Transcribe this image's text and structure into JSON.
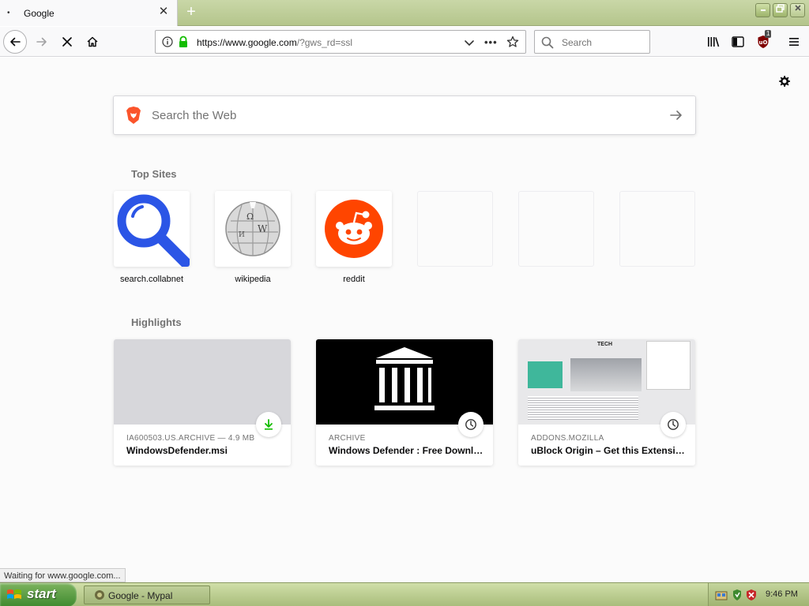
{
  "browser": {
    "tab": {
      "title": "Google",
      "dot": "•"
    },
    "new_tab_symbol": "+",
    "window_controls": {
      "minimize": "_",
      "maximize": "❐",
      "close": "✕"
    }
  },
  "navbar": {
    "url": {
      "main": "https://www.google.com",
      "rest": "/?gws_rd=ssl"
    },
    "more_symbol": "•••",
    "search_placeholder": "Search",
    "ublock_count": "1"
  },
  "newtab": {
    "search_placeholder": "Search the Web",
    "top_sites_title": "Top Sites",
    "top_sites": [
      {
        "label": "search.collabnet",
        "icon": "magnifier-icon"
      },
      {
        "label": "wikipedia",
        "icon": "wikipedia-globe-icon"
      },
      {
        "label": "reddit",
        "icon": "reddit-alien-icon"
      },
      {
        "label": "",
        "icon": ""
      },
      {
        "label": "",
        "icon": ""
      },
      {
        "label": "",
        "icon": ""
      }
    ],
    "highlights_title": "Highlights",
    "highlights": [
      {
        "source": "IA600503.US.ARCHIVE — 4.9 MB",
        "title": "WindowsDefender.msi",
        "badge": "download-icon"
      },
      {
        "source": "ARCHIVE",
        "title": "Windows Defender : Free Download, Borrow, and Streaming",
        "badge": "clock-icon"
      },
      {
        "source": "ADDONS.MOZILLA",
        "title": "uBlock Origin – Get this Extension for Firefox",
        "badge": "clock-icon",
        "thumb_heading": "TECH"
      }
    ]
  },
  "status_text": "Waiting for www.google.com...",
  "taskbar": {
    "start_label": "start",
    "task_label": "Google - Mypal",
    "clock": "9:46 PM"
  },
  "colors": {
    "accent": "#0a84ff",
    "brave_orange": "#fb542b",
    "reddit_orange": "#ff4500",
    "collabnet_blue": "#2b55e6",
    "download_green": "#12bc00",
    "xp_green": "#3f8a2f"
  }
}
